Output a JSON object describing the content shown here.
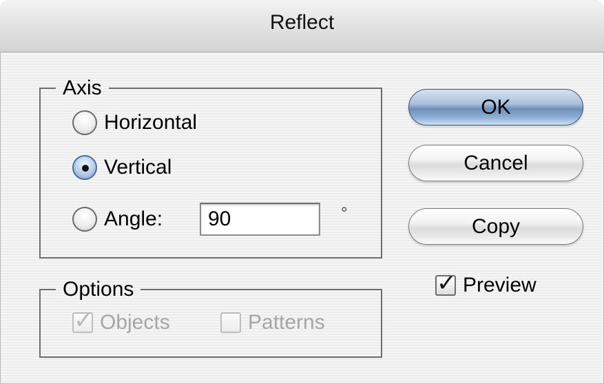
{
  "window": {
    "title": "Reflect"
  },
  "axis": {
    "legend": "Axis",
    "options": [
      {
        "label": "Horizontal",
        "selected": false
      },
      {
        "label": "Vertical",
        "selected": true
      },
      {
        "label": "Angle:",
        "selected": false
      }
    ],
    "angle_value": "90",
    "degree_symbol": "°"
  },
  "options_group": {
    "legend": "Options",
    "objects": {
      "label": "Objects",
      "checked": true,
      "enabled": false
    },
    "patterns": {
      "label": "Patterns",
      "checked": false,
      "enabled": false
    }
  },
  "buttons": {
    "ok": "OK",
    "cancel": "Cancel",
    "copy": "Copy"
  },
  "preview": {
    "label": "Preview",
    "checked": true
  },
  "icons": {
    "checkmark": "✓"
  }
}
